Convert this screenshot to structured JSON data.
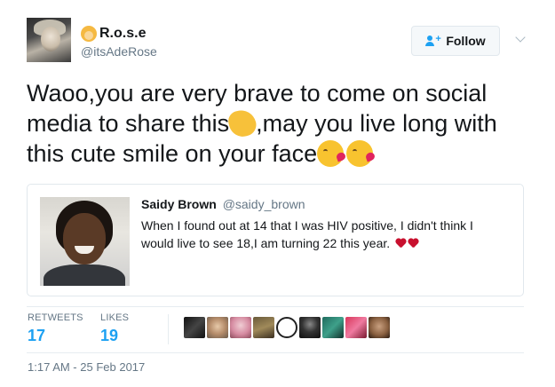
{
  "tweet": {
    "author": {
      "name": "R.o.s.e",
      "handle": "@itsAdeRose",
      "name_emoji": "person-blond-emoji"
    },
    "follow_label": "Follow",
    "text_parts": [
      "Waoo,you are very brave to come on social media to share this",
      ",may you live long with this cute smile on your face"
    ],
    "emoji": [
      "clapping-hands-emoji",
      "face-blowing-kiss-emoji",
      "face-blowing-kiss-emoji"
    ],
    "quoted": {
      "name": "Saidy Brown",
      "handle": "@saidy_brown",
      "text": "When I found out at 14 that I was HIV positive, I didn't think I would live to see 18,I am turning 22 this year.",
      "trailing_emoji": [
        "red-heart-emoji",
        "red-heart-emoji"
      ]
    },
    "stats": {
      "retweets_label": "RETWEETS",
      "retweets": "17",
      "likes_label": "LIKES",
      "likes": "19"
    },
    "liker_avatars": 9,
    "timestamp": "1:17 AM - 25 Feb 2017"
  },
  "colors": {
    "accent": "#1da1f2",
    "muted": "#657786",
    "border": "#e1e8ed",
    "heart": "#c8102e"
  }
}
